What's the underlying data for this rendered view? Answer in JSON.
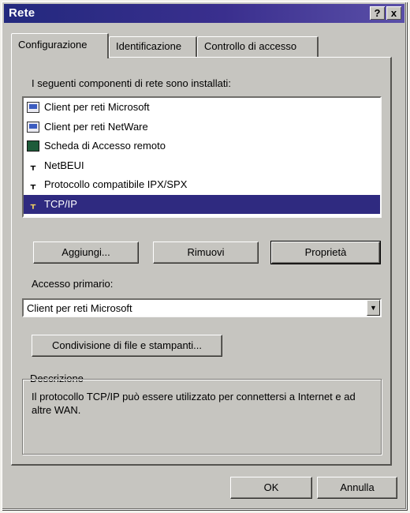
{
  "window": {
    "title": "Rete"
  },
  "titlebar": {
    "help_label": "?",
    "close_label": "x"
  },
  "tabs": [
    {
      "label": "Configurazione",
      "active": true
    },
    {
      "label": "Identificazione",
      "active": false
    },
    {
      "label": "Controllo di accesso",
      "active": false
    }
  ],
  "components": {
    "label": "I seguenti componenti di rete sono installati:",
    "items": [
      {
        "label": "Client per reti Microsoft",
        "icon": "network-client-icon"
      },
      {
        "label": "Client per reti NetWare",
        "icon": "network-client-icon"
      },
      {
        "label": "Scheda di Accesso remoto",
        "icon": "network-adapter-icon"
      },
      {
        "label": "NetBEUI",
        "icon": "protocol-icon"
      },
      {
        "label": "Protocollo compatibile IPX/SPX",
        "icon": "protocol-icon"
      },
      {
        "label": "TCP/IP",
        "icon": "protocol-icon",
        "selected": true
      }
    ]
  },
  "buttons": {
    "add": "Aggiungi...",
    "remove": "Rimuovi",
    "properties": "Proprietà",
    "sharing": "Condivisione di file e stampanti...",
    "ok": "OK",
    "cancel": "Annulla"
  },
  "primary_logon": {
    "label": "Accesso primario:",
    "value": "Client per reti Microsoft"
  },
  "description": {
    "title": "Descrizione",
    "text": "Il protocollo TCP/IP può essere utilizzato per connettersi a Internet e ad altre WAN."
  },
  "colors": {
    "titlebar": "#23297e",
    "selection": "#2f2a80",
    "face": "#c6c5c0"
  }
}
